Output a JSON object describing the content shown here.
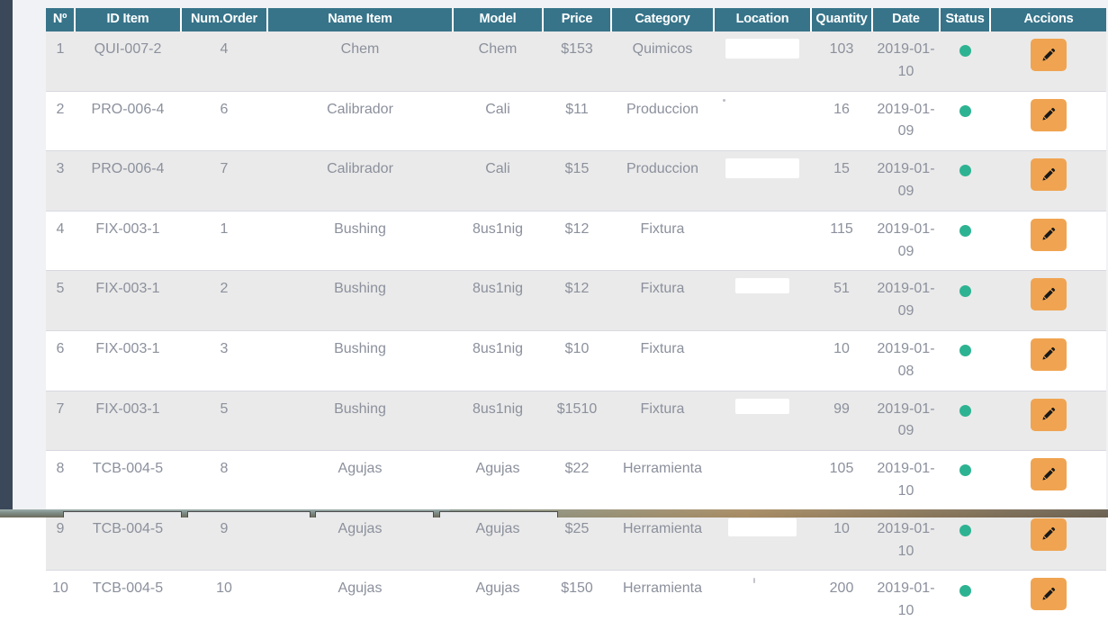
{
  "table": {
    "columns": [
      {
        "key": "no",
        "label": "Nº"
      },
      {
        "key": "id",
        "label": "ID Item"
      },
      {
        "key": "order",
        "label": "Num.Order"
      },
      {
        "key": "name",
        "label": "Name Item"
      },
      {
        "key": "model",
        "label": "Model"
      },
      {
        "key": "price",
        "label": "Price"
      },
      {
        "key": "category",
        "label": "Category"
      },
      {
        "key": "location",
        "label": "Location"
      },
      {
        "key": "quantity",
        "label": "Quantity"
      },
      {
        "key": "date",
        "label": "Date"
      },
      {
        "key": "status",
        "label": "Status"
      },
      {
        "key": "actions",
        "label": "Accions"
      }
    ],
    "rows": [
      {
        "no": "1",
        "id": "QUI-007-2",
        "order": "4",
        "name": "Chem",
        "model": "Chem",
        "price": "$153",
        "category": "Quimicos",
        "location": "",
        "location_style": "r-lg",
        "quantity": "103",
        "date": "2019-01-10",
        "status": "active",
        "action_label": "Edit"
      },
      {
        "no": "2",
        "id": "PRO-006-4",
        "order": "6",
        "name": "Calibrador",
        "model": "Cali",
        "price": "$11",
        "category": "Produccion",
        "location": "",
        "location_style": "r-dot",
        "quantity": "16",
        "date": "2019-01-09",
        "status": "active",
        "action_label": "Edit"
      },
      {
        "no": "3",
        "id": "PRO-006-4",
        "order": "7",
        "name": "Calibrador",
        "model": "Cali",
        "price": "$15",
        "category": "Produccion",
        "location": "",
        "location_style": "r-lg",
        "quantity": "15",
        "date": "2019-01-09",
        "status": "active",
        "action_label": "Edit"
      },
      {
        "no": "4",
        "id": "FIX-003-1",
        "order": "1",
        "name": "Bushing",
        "model": "8us1nig",
        "price": "$12",
        "category": "Fixtura",
        "location": "",
        "location_style": "r-none",
        "quantity": "115",
        "date": "2019-01-09",
        "status": "active",
        "action_label": "Edit"
      },
      {
        "no": "5",
        "id": "FIX-003-1",
        "order": "2",
        "name": "Bushing",
        "model": "8us1nig",
        "price": "$12",
        "category": "Fixtura",
        "location": "",
        "location_style": "r-sm",
        "quantity": "51",
        "date": "2019-01-09",
        "status": "active",
        "action_label": "Edit"
      },
      {
        "no": "6",
        "id": "FIX-003-1",
        "order": "3",
        "name": "Bushing",
        "model": "8us1nig",
        "price": "$10",
        "category": "Fixtura",
        "location": "",
        "location_style": "r-none",
        "quantity": "10",
        "date": "2019-01-08",
        "status": "active",
        "action_label": "Edit"
      },
      {
        "no": "7",
        "id": "FIX-003-1",
        "order": "5",
        "name": "Bushing",
        "model": "8us1nig",
        "price": "$1510",
        "category": "Fixtura",
        "location": "",
        "location_style": "r-sm",
        "quantity": "99",
        "date": "2019-01-09",
        "status": "active",
        "action_label": "Edit"
      },
      {
        "no": "8",
        "id": "TCB-004-5",
        "order": "8",
        "name": "Agujas",
        "model": "Agujas",
        "price": "$22",
        "category": "Herramienta",
        "location": "",
        "location_style": "r-none",
        "quantity": "105",
        "date": "2019-01-10",
        "status": "active",
        "action_label": "Edit"
      },
      {
        "no": "9",
        "id": "TCB-004-5",
        "order": "9",
        "name": "Agujas",
        "model": "Agujas",
        "price": "$25",
        "category": "Herramienta",
        "location": "",
        "location_style": "r-md",
        "quantity": "10",
        "date": "2019-01-10",
        "status": "active",
        "action_label": "Edit"
      },
      {
        "no": "10",
        "id": "TCB-004-5",
        "order": "10",
        "name": "Agujas",
        "model": "Agujas",
        "price": "$150",
        "category": "Herramienta",
        "location": "",
        "location_style": "r-tick",
        "quantity": "200",
        "date": "2019-01-10",
        "status": "active",
        "action_label": "Edit"
      }
    ]
  },
  "icons": {
    "edit": "pencil-icon",
    "status": "status-dot-icon"
  },
  "colors": {
    "header_background": "#37748a",
    "header_text": "#ffffff",
    "row_odd": "#eaeaea",
    "row_even": "#ffffff",
    "cell_text": "#8b909c",
    "status_active": "#2db392",
    "action_button": "#f0a451",
    "sidebar": "#3a4859",
    "page_background": "#f1f2f5"
  }
}
